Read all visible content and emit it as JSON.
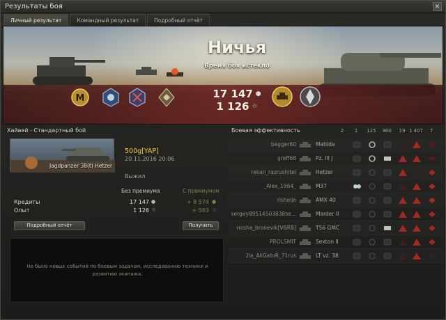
{
  "window": {
    "title": "Результаты боя",
    "close_label": "×"
  },
  "tabs": [
    {
      "label": "Личный результат",
      "active": true
    },
    {
      "label": "Командный результат",
      "active": false
    },
    {
      "label": "Подробный отчёт",
      "active": false
    }
  ],
  "banner": {
    "result": "Ничья",
    "subtitle": "Время боя истекло",
    "credits": "17 147",
    "xp": "1 126",
    "badges_left": [
      "mastery-m-badge",
      "achievement-badge-1",
      "achievement-badge-2",
      "rank-badge"
    ],
    "badges_right": [
      "medal-tank-badge",
      "wot-emblem-badge"
    ]
  },
  "personal": {
    "battle_header": "Хайвей - Стандартный бой",
    "vehicle_name": "Jagdpanzer 38(t) Hetzer",
    "player_name": "500g[YAP]",
    "date": "20.11.2016 20:06",
    "status": "Выжил",
    "col_no_premium": "Без премиума",
    "col_premium": "С премиумом",
    "credits_label": "Кредиты",
    "credits_value": "17 147",
    "credits_premium": "+ 8 574",
    "xp_label": "Опыт",
    "xp_value": "1 126",
    "xp_premium": "+ 563",
    "details_button": "Подробный отчёт",
    "receive_button": "Получить",
    "events_text": "Не было новых событий по боевым задачам, исследованию техники и развитию экипажа."
  },
  "efficiency": {
    "header": "Боевая эффективность",
    "columns": [
      "2",
      "1",
      "125",
      "360",
      "19",
      "1 407",
      "7"
    ],
    "rows": [
      {
        "player": "bagger60",
        "tank": "Matilda"
      },
      {
        "player": "greff68",
        "tank": "Pz. III J"
      },
      {
        "player": "rakan_razrushitel",
        "tank": "Hetzer"
      },
      {
        "player": "_Alex_1964_",
        "tank": "M37"
      },
      {
        "player": "rishelje",
        "tank": "AMX 40"
      },
      {
        "player": "sergey89514503838se...",
        "tank": "Marder II"
      },
      {
        "player": "misha_bronevik[VBRB]",
        "tank": "T56 GMC"
      },
      {
        "player": "PROLSMIT",
        "tank": "Sexton II"
      },
      {
        "player": "2la_AliGatoR_71rus",
        "tank": "LT vz. 38"
      }
    ]
  },
  "colors": {
    "accent_gold": "#f1c94b",
    "premium_green": "#6f8c4a",
    "banner_red": "#692323"
  }
}
